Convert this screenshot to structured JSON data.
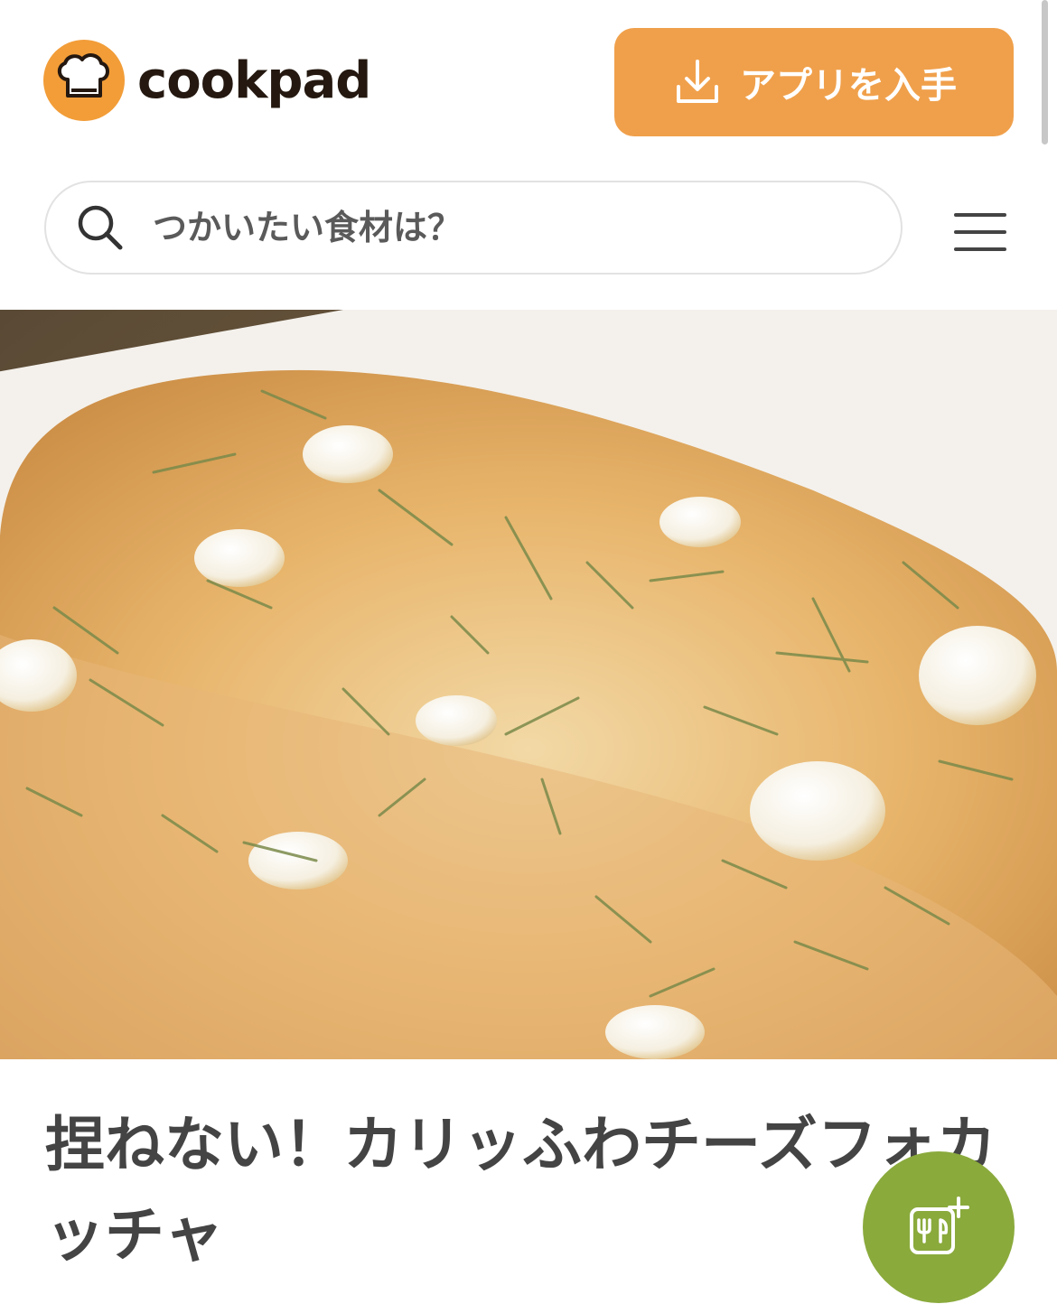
{
  "header": {
    "logo_text": "cookpad",
    "app_button_label": "アプリを入手"
  },
  "search": {
    "placeholder": "つかいたい食材は？"
  },
  "recipe": {
    "title": "捏ねない！カリッふわチーズフォカッチャ"
  },
  "icons": [
    "chef-hat-icon",
    "download-icon",
    "search-icon",
    "hamburger-menu-icon",
    "add-recipe-icon"
  ],
  "colors": {
    "brand_orange": "#f0a04b",
    "fab_green": "#8aaa3c",
    "title_text": "#444444"
  }
}
